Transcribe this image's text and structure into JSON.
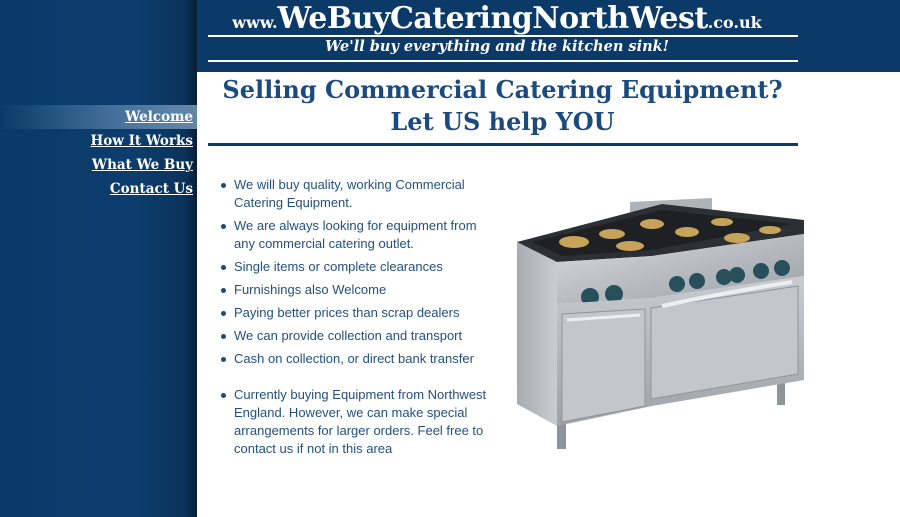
{
  "header": {
    "logo": {
      "prefix": "www.",
      "main": "WeBuyCateringNorthWest",
      "suffix": ".co.uk"
    },
    "tagline": "We'll buy everything and the kitchen sink!"
  },
  "nav": {
    "items": [
      {
        "label": "Welcome",
        "active": true
      },
      {
        "label": "How It Works",
        "active": false
      },
      {
        "label": "What We Buy",
        "active": false
      },
      {
        "label": "Contact Us",
        "active": false
      }
    ]
  },
  "main": {
    "headline_line1": "Selling Commercial Catering Equipment?",
    "headline_line2": "Let US help YOU",
    "features": [
      "We will buy quality, working Commercial Catering Equipment.",
      "We are always looking for equipment from any commercial catering outlet.",
      "Single items or complete clearances",
      "Furnishings also Welcome",
      "Paying better prices than scrap dealers",
      "We can provide collection and transport",
      "Cash on collection, or direct bank transfer",
      "Currently buying Equipment from Northwest England. However, we can make special arrangements for larger orders. Feel free to contact us if not in this area"
    ],
    "image": {
      "icon": "commercial-gas-range-icon"
    }
  },
  "colors": {
    "brand_navy": "#0b3a68",
    "heading_blue": "#1a4a7e",
    "text_blue": "#24507f",
    "white": "#ffffff"
  }
}
